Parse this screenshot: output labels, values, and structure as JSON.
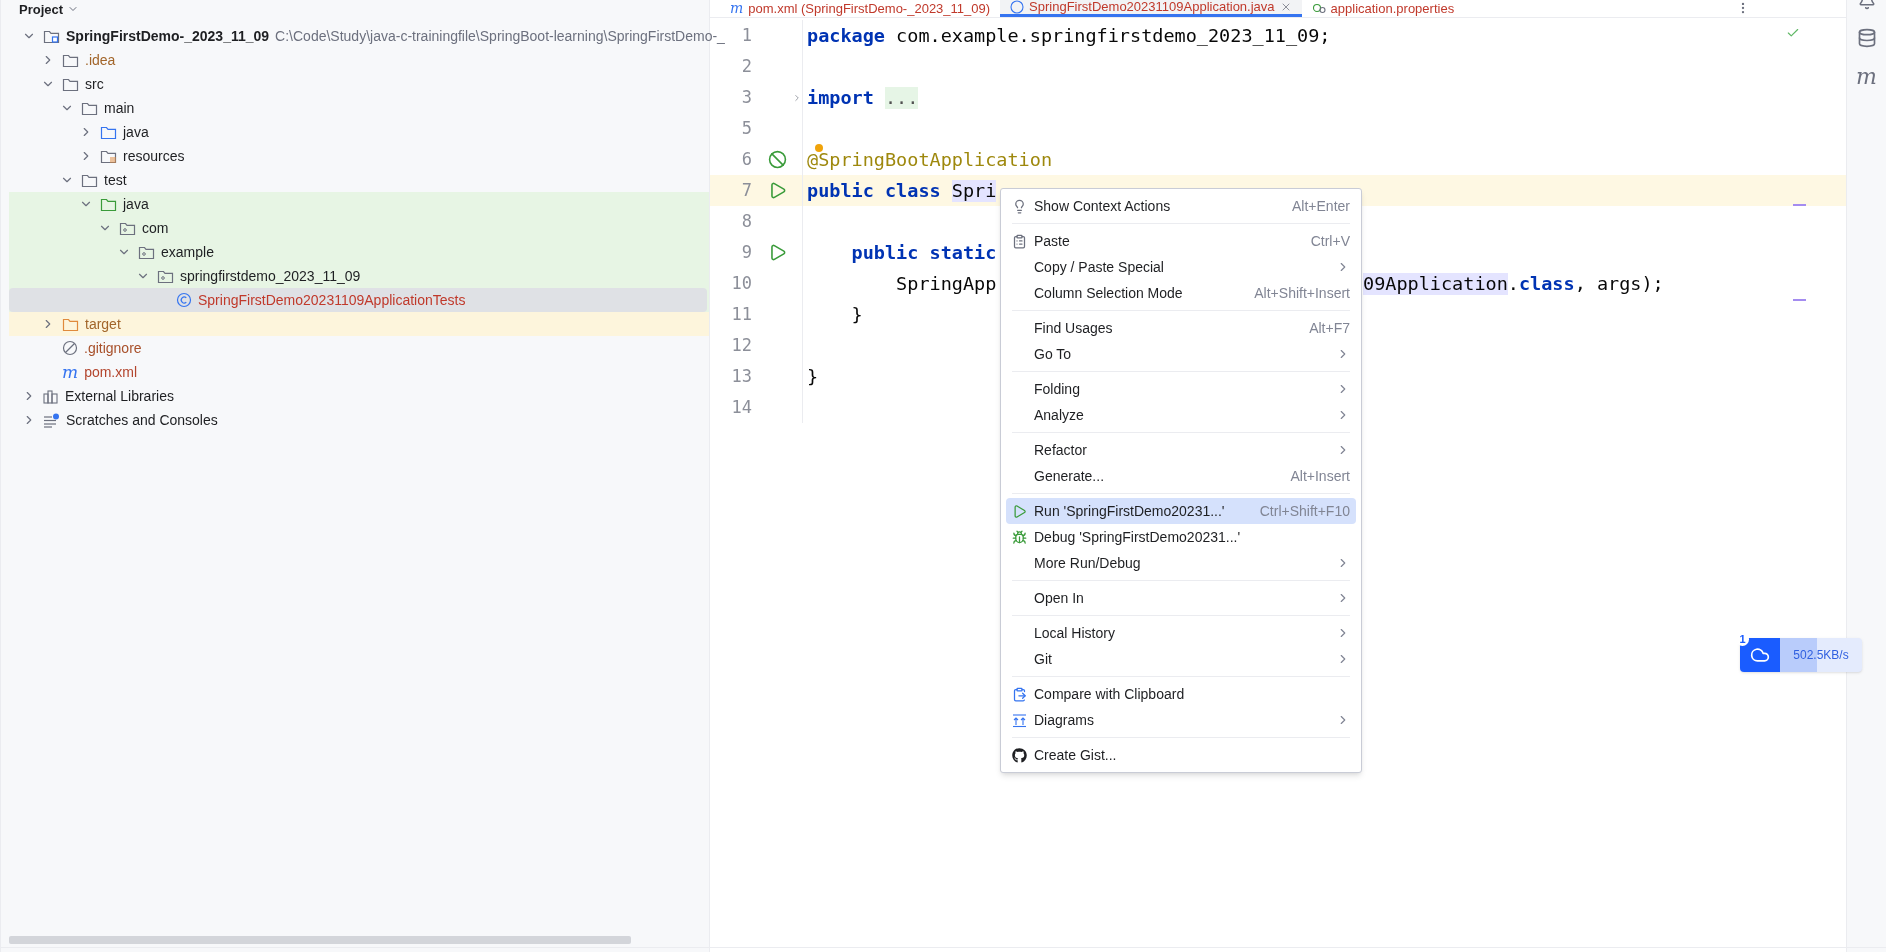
{
  "project_panel": {
    "title": "Project",
    "tree": [
      {
        "label": "SpringFirstDemo-_2023_11_09",
        "path": "C:\\Code\\Study\\java-c-trainingfile\\SpringBoot-learning\\SpringFirstDemo-_",
        "kind": "module",
        "expanded": true,
        "selected": false,
        "children": [
          {
            "label": ".idea",
            "kind": "folder",
            "color": "#a2652a",
            "expanded": false,
            "selected": false
          },
          {
            "label": "src",
            "kind": "folder",
            "expanded": true,
            "selected": false,
            "children": [
              {
                "label": "main",
                "kind": "folder",
                "expanded": true,
                "selected": false,
                "children": [
                  {
                    "label": "java",
                    "kind": "source-folder",
                    "expanded": false,
                    "selected": false
                  },
                  {
                    "label": "resources",
                    "kind": "resources-folder",
                    "expanded": false,
                    "selected": false
                  }
                ]
              },
              {
                "label": "test",
                "kind": "folder",
                "expanded": true,
                "selected": false,
                "children": [
                  {
                    "label": "java",
                    "kind": "test-folder",
                    "in_test_sources": true,
                    "expanded": true,
                    "selected": false,
                    "children": [
                      {
                        "label": "com",
                        "kind": "package",
                        "in_test_sources": true,
                        "expanded": true,
                        "selected": false,
                        "children": [
                          {
                            "label": "example",
                            "kind": "package",
                            "in_test_sources": true,
                            "expanded": true,
                            "selected": false,
                            "children": [
                              {
                                "label": "springfirstdemo_2023_11_09",
                                "kind": "package",
                                "in_test_sources": true,
                                "expanded": true,
                                "selected": false,
                                "children": [
                                  {
                                    "label": "SpringFirstDemo20231109ApplicationTests",
                                    "kind": "class",
                                    "in_test_sources": true,
                                    "color": "#c0392b",
                                    "selected": true
                                  }
                                ]
                              }
                            ]
                          }
                        ]
                      }
                    ]
                  }
                ]
              }
            ]
          },
          {
            "label": "target",
            "kind": "excluded-folder",
            "excluded": true,
            "color": "#a2652a",
            "expanded": false,
            "selected": false
          },
          {
            "label": ".gitignore",
            "kind": "ignored-file",
            "color": "#a8502a",
            "selected": false
          },
          {
            "label": "pom.xml",
            "kind": "maven",
            "glyph": "m",
            "color": "#b3452d",
            "selected": false
          }
        ]
      },
      {
        "label": "External Libraries",
        "kind": "libraries",
        "expanded": false,
        "selected": false
      },
      {
        "label": "Scratches and Consoles",
        "kind": "scratches",
        "expanded": false,
        "selected": false
      }
    ]
  },
  "editor_tabs": [
    {
      "label": "pom.xml (SpringFirstDemo-_2023_11_09)",
      "kind": "maven",
      "glyph": "m",
      "selected": false
    },
    {
      "label": "SpringFirstDemo20231109Application.java",
      "kind": "spring-class",
      "selected": true,
      "closable": true
    },
    {
      "label": "application.properties",
      "kind": "properties",
      "selected": false
    }
  ],
  "code_lines": [
    {
      "number": "1",
      "segments": [
        {
          "kind": "keyword",
          "text": "package"
        },
        {
          "kind": "plain",
          "text": " com.example.springfirstdemo_2023_11_09;"
        }
      ]
    },
    {
      "number": "2"
    },
    {
      "number": "3",
      "fold": true,
      "segments": [
        {
          "kind": "keyword",
          "text": "import "
        },
        {
          "kind": "folded",
          "text": "..."
        }
      ]
    },
    {
      "number": "5"
    },
    {
      "number": "6",
      "gutter": {
        "kind": "bean"
      },
      "hint_dot": true,
      "segments": [
        {
          "kind": "annotation",
          "text": "@SpringBootApplication"
        }
      ]
    },
    {
      "number": "7",
      "gutter": {
        "kind": "run"
      },
      "current": true,
      "segments": [
        {
          "kind": "keyword",
          "text": "public class "
        },
        {
          "kind": "selected",
          "text": "Spri"
        }
      ]
    },
    {
      "number": "8"
    },
    {
      "number": "9",
      "gutter": {
        "kind": "run"
      },
      "segments": [
        {
          "kind": "keyword",
          "text": "    public static"
        }
      ]
    },
    {
      "number": "10",
      "segments": [
        {
          "kind": "plain",
          "text": "        SpringApp"
        }
      ],
      "right_segments": [
        {
          "kind": "selected",
          "text": "09Application"
        },
        {
          "kind": "plain",
          "text": "."
        },
        {
          "kind": "keyword",
          "text": "class"
        },
        {
          "kind": "plain",
          "text": ", args);"
        }
      ]
    },
    {
      "number": "11",
      "segments": [
        {
          "kind": "plain",
          "text": "    }"
        }
      ]
    },
    {
      "number": "12"
    },
    {
      "number": "13",
      "segments": [
        {
          "kind": "plain",
          "text": "}"
        }
      ]
    },
    {
      "number": "14"
    }
  ],
  "context_menu": {
    "sections": [
      [
        {
          "label": "Show Context Actions",
          "kind": "bulb",
          "shortcut": "Alt+Enter",
          "selected": false
        }
      ],
      [
        {
          "label": "Paste",
          "kind": "clipboard",
          "shortcut": "Ctrl+V",
          "selected": false
        },
        {
          "label": "Copy / Paste Special",
          "submenu": true,
          "selected": false
        },
        {
          "label": "Column Selection Mode",
          "shortcut": "Alt+Shift+Insert",
          "selected": false
        }
      ],
      [
        {
          "label": "Find Usages",
          "shortcut": "Alt+F7",
          "selected": false
        },
        {
          "label": "Go To",
          "submenu": true,
          "selected": false
        }
      ],
      [
        {
          "label": "Folding",
          "submenu": true,
          "selected": false
        },
        {
          "label": "Analyze",
          "submenu": true,
          "selected": false
        }
      ],
      [
        {
          "label": "Refactor",
          "submenu": true,
          "selected": false
        },
        {
          "label": "Generate...",
          "shortcut": "Alt+Insert",
          "selected": false
        }
      ],
      [
        {
          "label": "Run 'SpringFirstDemo20231...'",
          "kind": "run",
          "shortcut": "Ctrl+Shift+F10",
          "selected": true
        },
        {
          "label": "Debug 'SpringFirstDemo20231...'",
          "kind": "bug",
          "selected": false
        },
        {
          "label": "More Run/Debug",
          "submenu": true,
          "selected": false
        }
      ],
      [
        {
          "label": "Open In",
          "submenu": true,
          "selected": false
        }
      ],
      [
        {
          "label": "Local History",
          "submenu": true,
          "selected": false
        },
        {
          "label": "Git",
          "submenu": true,
          "selected": false
        }
      ],
      [
        {
          "label": "Compare with Clipboard",
          "kind": "compare",
          "selected": false
        },
        {
          "label": "Diagrams",
          "kind": "diagram",
          "submenu": true,
          "selected": false
        }
      ],
      [
        {
          "label": "Create Gist...",
          "kind": "github",
          "selected": false
        }
      ]
    ]
  },
  "right_toolbar": [
    {
      "kind": "bell"
    },
    {
      "kind": "database"
    },
    {
      "kind": "maven",
      "glyph": "m"
    }
  ],
  "network_widget": {
    "badge": "1",
    "speed": "502.5KB/s",
    "level": 0.45
  }
}
